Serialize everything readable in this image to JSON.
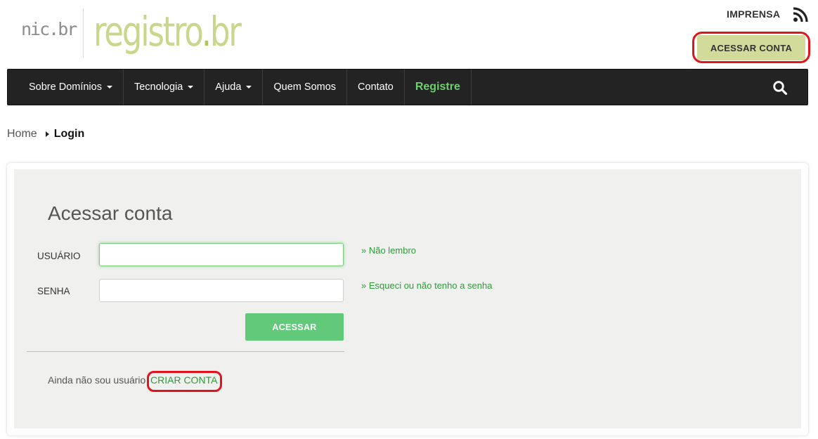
{
  "header": {
    "logo_nic": "nic.br",
    "logo_registro": "registro",
    "logo_dot": ".",
    "logo_br": "br",
    "imprensa": "IMPRENSA",
    "acessar_conta": "ACESSAR CONTA"
  },
  "nav": {
    "items": [
      {
        "label": "Sobre Domínios",
        "dropdown": true
      },
      {
        "label": "Tecnologia",
        "dropdown": true
      },
      {
        "label": "Ajuda",
        "dropdown": true
      },
      {
        "label": "Quem Somos",
        "dropdown": false
      },
      {
        "label": "Contato",
        "dropdown": false
      },
      {
        "label": "Registre",
        "dropdown": false
      }
    ]
  },
  "breadcrumb": {
    "home": "Home",
    "current": "Login"
  },
  "form": {
    "title": "Acessar conta",
    "usuario_label": "USUÁRIO",
    "usuario_value": "",
    "senha_label": "SENHA",
    "senha_value": "",
    "nao_lembro": "» Não lembro",
    "esqueci": "» Esqueci ou não tenho a senha",
    "submit": "ACESSAR",
    "no_account_text": "Ainda não sou usuário",
    "criar_conta": "CRIAR CONTA"
  },
  "colors": {
    "accent_green": "#2f9a3a",
    "button_green": "#63c97a",
    "nav_bg": "#232323",
    "highlight_red": "#e0141c",
    "top_button": "#d2db9a"
  },
  "icons": [
    "rss-icon",
    "search-icon",
    "caret-down-icon",
    "breadcrumb-arrow-icon"
  ]
}
